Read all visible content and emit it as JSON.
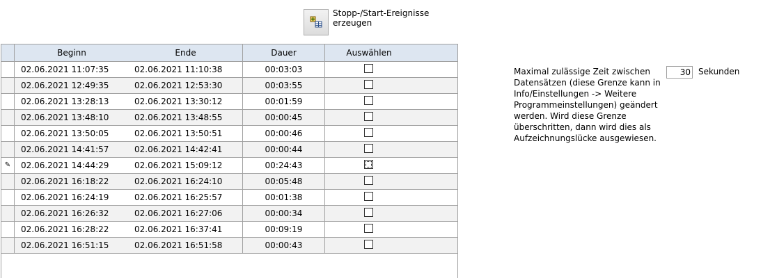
{
  "toolbar": {
    "generate_icon": "grid-add-icon",
    "generate_label": "Stopp-/Start-Ereignisse erzeugen"
  },
  "table": {
    "columns": [
      "Beginn",
      "Ende",
      "Dauer",
      "Auswählen"
    ],
    "rows": [
      {
        "beginn": "02.06.2021 11:07:35",
        "ende": "02.06.2021 11:10:38",
        "dauer": "00:03:03",
        "selected": false
      },
      {
        "beginn": "02.06.2021 12:49:35",
        "ende": "02.06.2021 12:53:30",
        "dauer": "00:03:55",
        "selected": false
      },
      {
        "beginn": "02.06.2021 13:28:13",
        "ende": "02.06.2021 13:30:12",
        "dauer": "00:01:59",
        "selected": false
      },
      {
        "beginn": "02.06.2021 13:48:10",
        "ende": "02.06.2021 13:48:55",
        "dauer": "00:00:45",
        "selected": false
      },
      {
        "beginn": "02.06.2021 13:50:05",
        "ende": "02.06.2021 13:50:51",
        "dauer": "00:00:46",
        "selected": false
      },
      {
        "beginn": "02.06.2021 14:41:57",
        "ende": "02.06.2021 14:42:41",
        "dauer": "00:00:44",
        "selected": false
      },
      {
        "beginn": "02.06.2021 14:44:29",
        "ende": "02.06.2021 15:09:12",
        "dauer": "00:24:43",
        "selected": false,
        "editing": true
      },
      {
        "beginn": "02.06.2021 16:18:22",
        "ende": "02.06.2021 16:24:10",
        "dauer": "00:05:48",
        "selected": false
      },
      {
        "beginn": "02.06.2021 16:24:19",
        "ende": "02.06.2021 16:25:57",
        "dauer": "00:01:38",
        "selected": false
      },
      {
        "beginn": "02.06.2021 16:26:32",
        "ende": "02.06.2021 16:27:06",
        "dauer": "00:00:34",
        "selected": false
      },
      {
        "beginn": "02.06.2021 16:28:22",
        "ende": "02.06.2021 16:37:41",
        "dauer": "00:09:19",
        "selected": false
      },
      {
        "beginn": "02.06.2021 16:51:15",
        "ende": "02.06.2021 16:51:58",
        "dauer": "00:00:43",
        "selected": false
      }
    ]
  },
  "settings": {
    "info_text": "Maximal zulässige Zeit zwischen Datensätzen (diese Grenze kann in Info/Einstellungen -> Weitere Programmeinstellungen) geändert werden. Wird diese Grenze überschritten, dann wird dies als Aufzeichnungslücke ausgewiesen.",
    "seconds_value": "30",
    "seconds_label": "Sekunden"
  }
}
